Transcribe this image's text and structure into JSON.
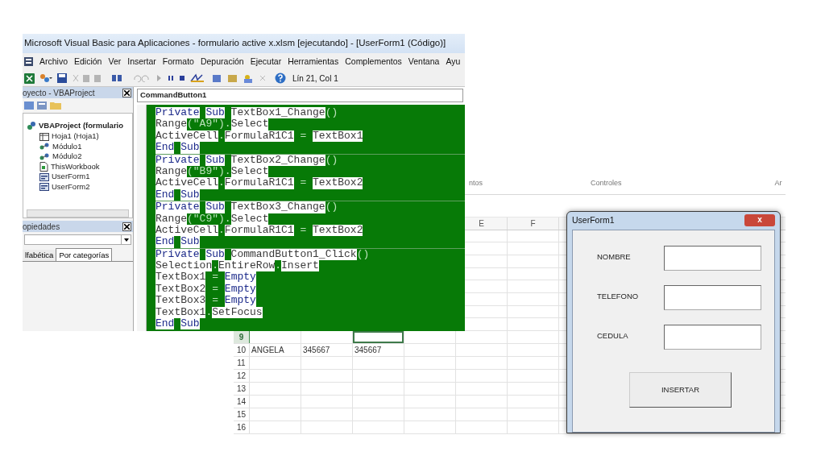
{
  "excel": {
    "ribbon_groups": [
      "ntos",
      "Controles",
      "Ar"
    ],
    "columns": [
      "E",
      "F"
    ],
    "rows": [
      {
        "number": "9",
        "selected": true,
        "cells": [
          "",
          "",
          ""
        ]
      },
      {
        "number": "10",
        "selected": false,
        "cells": [
          "ANGELA",
          "345667",
          "345667"
        ]
      },
      {
        "number": "11",
        "selected": false,
        "cells": []
      },
      {
        "number": "12",
        "selected": false,
        "cells": []
      },
      {
        "number": "13",
        "selected": false,
        "cells": []
      },
      {
        "number": "14",
        "selected": false,
        "cells": []
      },
      {
        "number": "15",
        "selected": false,
        "cells": []
      },
      {
        "number": "16",
        "selected": false,
        "cells": []
      }
    ]
  },
  "vba_window": {
    "title": "Microsoft Visual Basic para Aplicaciones - formulario active x.xlsm [ejecutando] - [UserForm1 (Código)]",
    "menu": [
      "Archivo",
      "Edición",
      "Ver",
      "Insertar",
      "Formato",
      "Depuración",
      "Ejecutar",
      "Herramientas",
      "Complementos",
      "Ventana",
      "Ayu"
    ],
    "cursor_position": "Lín 21, Col 1",
    "project_panel": {
      "title": "oyecto - VBAProject",
      "tree": [
        {
          "label": "VBAProject (formulario",
          "children": [
            {
              "label": "Hoja1 (Hoja1)",
              "kind": "sheet"
            },
            {
              "label": "Módulo1",
              "kind": "module"
            },
            {
              "label": "Módulo2",
              "kind": "module"
            },
            {
              "label": "ThisWorkbook",
              "kind": "workbook"
            },
            {
              "label": "UserForm1",
              "kind": "form"
            },
            {
              "label": "UserForm2",
              "kind": "form"
            }
          ]
        }
      ]
    },
    "properties_panel": {
      "title": "opiedades",
      "tabs": [
        {
          "label": "lfabética",
          "selected": false
        },
        {
          "label": "Por categorías",
          "selected": true
        }
      ]
    },
    "object_combo": "CommandButton1",
    "procedures": [
      {
        "lines": [
          [
            {
              "text": "Private",
              "kind": "keyword"
            },
            {
              "text": "Sub",
              "kind": "keyword"
            },
            {
              "text": "TextBox1_Change",
              "kind": "plain"
            },
            {
              "text": "()",
              "kind": "gap"
            }
          ],
          [
            {
              "text": "Range",
              "kind": "plain"
            },
            {
              "text": "(\"A9\").",
              "kind": "gap"
            },
            {
              "text": "Select",
              "kind": "plain"
            }
          ],
          [
            {
              "text": "ActiveCell",
              "kind": "plain"
            },
            {
              "text": ".",
              "kind": "gap"
            },
            {
              "text": "FormulaR1C1",
              "kind": "plain"
            },
            {
              "text": " = ",
              "kind": "gap"
            },
            {
              "text": "TextBox1",
              "kind": "plain"
            }
          ],
          [
            {
              "text": "End",
              "kind": "keyword"
            },
            {
              "text": "Sub",
              "kind": "keyword"
            }
          ]
        ]
      },
      {
        "lines": [
          [
            {
              "text": "Private",
              "kind": "keyword"
            },
            {
              "text": "Sub",
              "kind": "keyword"
            },
            {
              "text": "TextBox2_Change",
              "kind": "plain"
            },
            {
              "text": "()",
              "kind": "gap"
            }
          ],
          [
            {
              "text": "Range",
              "kind": "plain"
            },
            {
              "text": "(\"B9\").",
              "kind": "gap"
            },
            {
              "text": "Select",
              "kind": "plain"
            }
          ],
          [
            {
              "text": "ActiveCell",
              "kind": "plain"
            },
            {
              "text": ".",
              "kind": "gap"
            },
            {
              "text": "FormulaR1C1",
              "kind": "plain"
            },
            {
              "text": " = ",
              "kind": "gap"
            },
            {
              "text": "TextBox2",
              "kind": "plain"
            }
          ],
          [
            {
              "text": "End",
              "kind": "keyword"
            },
            {
              "text": "Sub",
              "kind": "keyword"
            }
          ]
        ]
      },
      {
        "lines": [
          [
            {
              "text": "Private",
              "kind": "keyword"
            },
            {
              "text": "Sub",
              "kind": "keyword"
            },
            {
              "text": "TextBox3_Change",
              "kind": "plain"
            },
            {
              "text": "()",
              "kind": "gap"
            }
          ],
          [
            {
              "text": "Range",
              "kind": "plain"
            },
            {
              "text": "(\"C9\").",
              "kind": "gap"
            },
            {
              "text": "Select",
              "kind": "plain"
            }
          ],
          [
            {
              "text": "ActiveCell",
              "kind": "plain"
            },
            {
              "text": ".",
              "kind": "gap"
            },
            {
              "text": "FormulaR1C1",
              "kind": "plain"
            },
            {
              "text": " = ",
              "kind": "gap"
            },
            {
              "text": "TextBox2",
              "kind": "plain"
            }
          ],
          [
            {
              "text": "End",
              "kind": "keyword"
            },
            {
              "text": "Sub",
              "kind": "keyword"
            }
          ]
        ]
      },
      {
        "lines": [
          [
            {
              "text": "Private",
              "kind": "keyword"
            },
            {
              "text": "Sub",
              "kind": "keyword"
            },
            {
              "text": "CommandButton1_Click",
              "kind": "plain"
            },
            {
              "text": "()",
              "kind": "gap"
            }
          ],
          [
            {
              "text": "Selection",
              "kind": "plain"
            },
            {
              "text": ".",
              "kind": "gap"
            },
            {
              "text": "EntireRow",
              "kind": "plain"
            },
            {
              "text": ".",
              "kind": "gap"
            },
            {
              "text": "Insert",
              "kind": "plain"
            }
          ],
          [
            {
              "text": "TextBox1",
              "kind": "plain"
            },
            {
              "text": " = ",
              "kind": "gap"
            },
            {
              "text": "Empty",
              "kind": "keyword"
            }
          ],
          [
            {
              "text": "TextBox2",
              "kind": "plain"
            },
            {
              "text": " = ",
              "kind": "gap"
            },
            {
              "text": "Empty",
              "kind": "keyword"
            }
          ],
          [
            {
              "text": "TextBox3",
              "kind": "plain"
            },
            {
              "text": " = ",
              "kind": "gap"
            },
            {
              "text": "Empty",
              "kind": "keyword"
            }
          ],
          [
            {
              "text": "TextBox1",
              "kind": "plain"
            },
            {
              "text": ".",
              "kind": "gap"
            },
            {
              "text": "SetFocus",
              "kind": "plain"
            }
          ],
          [
            {
              "text": "End",
              "kind": "keyword"
            },
            {
              "text": "Sub",
              "kind": "keyword"
            }
          ]
        ]
      }
    ]
  },
  "userform": {
    "title": "UserForm1",
    "close": "x",
    "fields": [
      {
        "label": "NOMBRE"
      },
      {
        "label": "TELEFONO"
      },
      {
        "label": "CEDULA"
      }
    ],
    "button": "INSERTAR"
  }
}
